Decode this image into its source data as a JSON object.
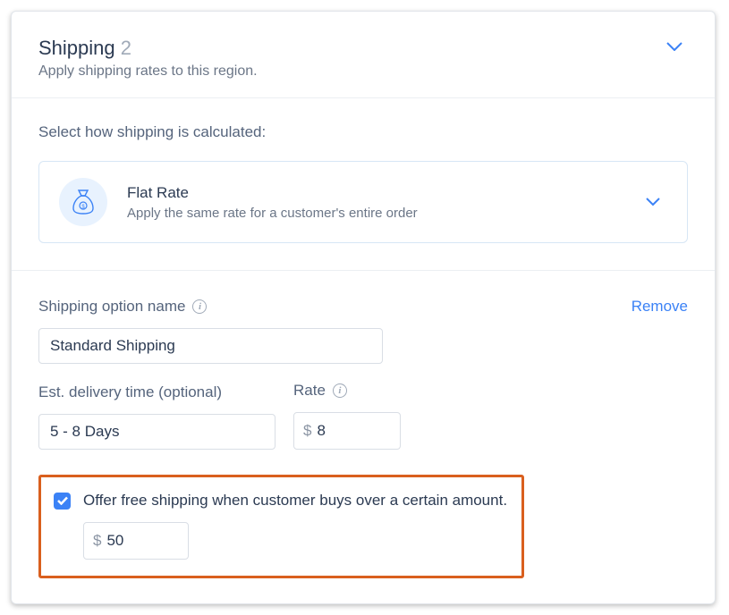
{
  "header": {
    "title": "Shipping",
    "step": "2",
    "subtitle": "Apply shipping rates to this region."
  },
  "calc": {
    "section_title": "Select how shipping is calculated:",
    "title": "Flat Rate",
    "subtitle": "Apply the same rate for a customer's entire order"
  },
  "form": {
    "name_label": "Shipping option name",
    "remove_label": "Remove",
    "name_value": "Standard Shipping",
    "delivery_label": "Est. delivery time (optional)",
    "delivery_value": "5 - 8 Days",
    "rate_label": "Rate",
    "rate_prefix": "$",
    "rate_value": "8"
  },
  "free_ship": {
    "label": "Offer free shipping when customer buys over a certain amount.",
    "prefix": "$",
    "value": "50"
  }
}
